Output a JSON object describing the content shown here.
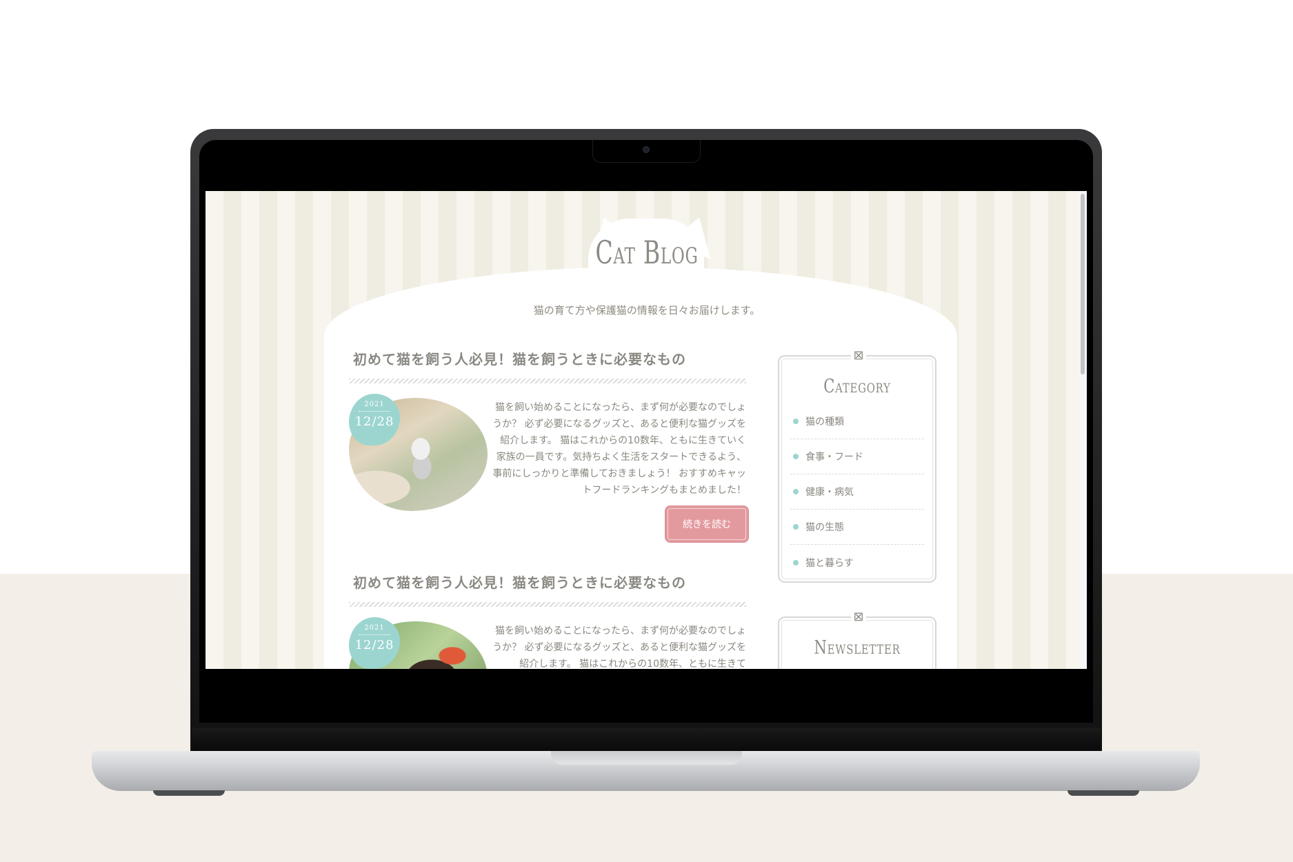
{
  "site": {
    "title": "Cat Blog",
    "tagline": "猫の育て方や保護猫の情報を日々お届けします。"
  },
  "posts": [
    {
      "title": "初めて猫を飼う人必見！猫を飼うときに必要なもの",
      "date_year": "2021",
      "date_day": "12/28",
      "excerpt": "猫を飼い始めることになったら、まず何が必要なのでしょうか？ 必ず必要になるグッズと、あると便利な猫グッズを紹介します。 猫はこれからの10数年、ともに生きていく家族の一員です。気持ちよく生活をスタートできるよう、 事前にしっかりと準備しておきましょう！ おすすめキャットフードランキングもまとめました！",
      "read_more": "続きを読む"
    },
    {
      "title": "初めて猫を飼う人必見！猫を飼うときに必要なもの",
      "date_year": "2021",
      "date_day": "12/28",
      "excerpt": "猫を飼い始めることになったら、まず何が必要なのでしょうか？ 必ず必要になるグッズと、あると便利な猫グッズを紹介します。 猫はこれからの10数年、ともに生きて"
    }
  ],
  "sidebar": {
    "category": {
      "title": "Category",
      "icon": "envelope-icon",
      "items": [
        {
          "label": "猫の種類"
        },
        {
          "label": "食事・フード"
        },
        {
          "label": "健康・病気"
        },
        {
          "label": "猫の生態"
        },
        {
          "label": "猫と暮らす"
        }
      ]
    },
    "newsletter": {
      "title": "Newsletter",
      "icon": "envelope-icon"
    }
  },
  "colors": {
    "accent_mint": "#9cd5cf",
    "button_pink": "#e39a9f",
    "text_gray": "#8a877f",
    "stripe_light": "#f7f5ee",
    "stripe_dark": "#efece1"
  }
}
